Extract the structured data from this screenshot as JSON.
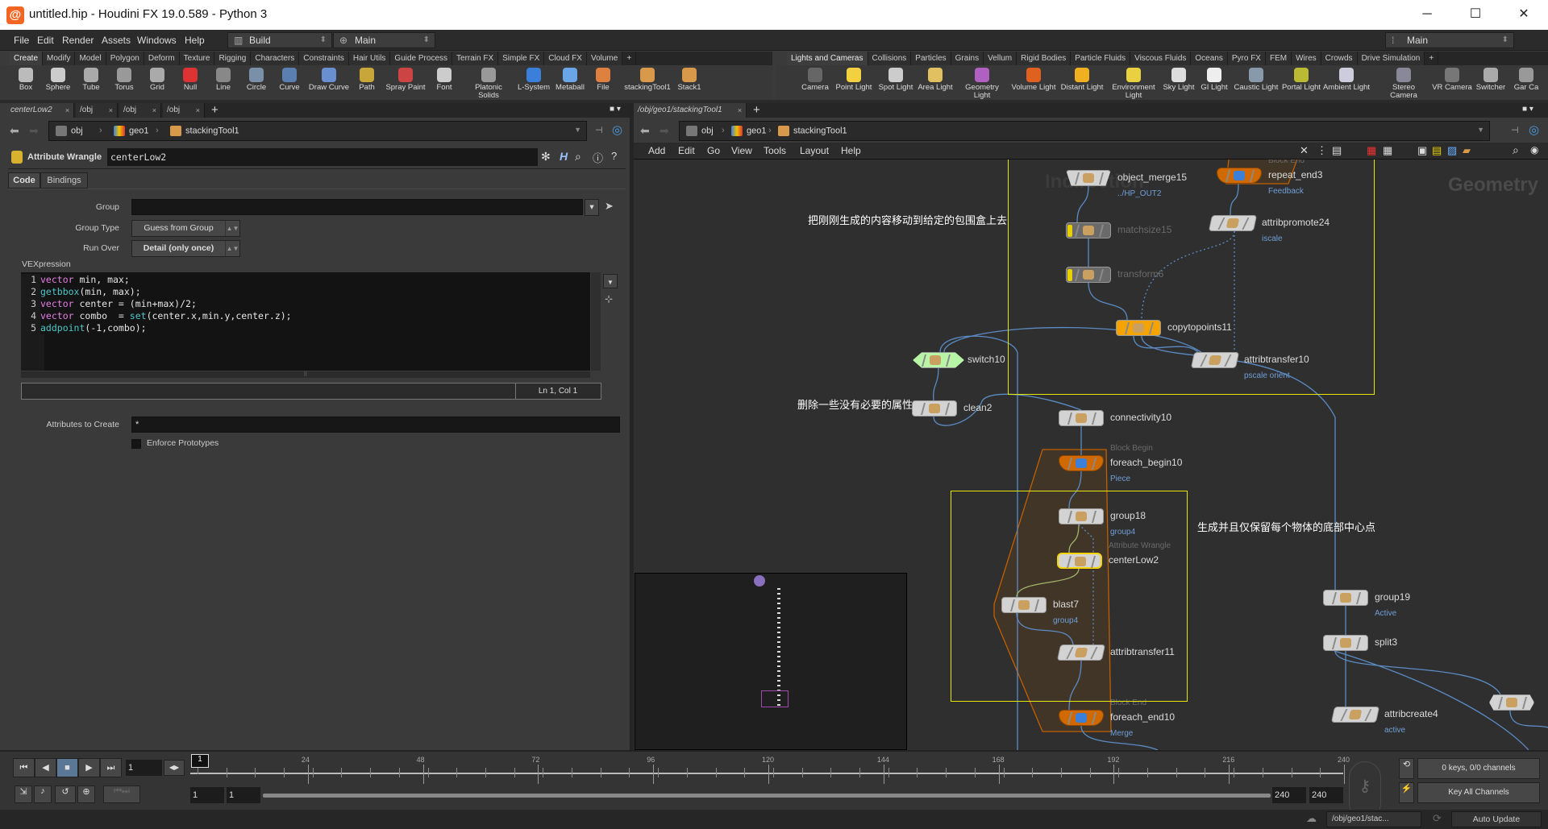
{
  "window": {
    "title": "untitled.hip - Houdini FX 19.0.589 - Python 3",
    "logo": "houdini-logo",
    "minimize": "─",
    "maximize": "☐",
    "close": "✕"
  },
  "menubar": {
    "items": [
      "File",
      "Edit",
      "Render",
      "Assets",
      "Windows",
      "Help"
    ],
    "desktop": "Build",
    "context": "Main",
    "right_context": "Main"
  },
  "shelf_left": {
    "tabs": [
      "Create",
      "Modify",
      "Model",
      "Polygon",
      "Deform",
      "Texture",
      "Rigging",
      "Characters",
      "Constraints",
      "Hair Utils",
      "Guide Process",
      "Terrain FX",
      "Simple FX",
      "Cloud FX",
      "Volume"
    ],
    "active_tab": "Create",
    "tools": [
      "Box",
      "Sphere",
      "Tube",
      "Torus",
      "Grid",
      "Null",
      "Line",
      "Circle",
      "Curve",
      "Draw Curve",
      "Path",
      "Spray Paint",
      "Font",
      "Platonic Solids",
      "L-System",
      "Metaball",
      "File",
      "stackingTool1",
      "Stack1"
    ]
  },
  "shelf_right": {
    "tabs": [
      "Lights and Cameras",
      "Collisions",
      "Particles",
      "Grains",
      "Vellum",
      "Rigid Bodies",
      "Particle Fluids",
      "Viscous Fluids",
      "Oceans",
      "Pyro FX",
      "FEM",
      "Wires",
      "Crowds",
      "Drive Simulation"
    ],
    "active_tab": "Lights and Cameras",
    "tools": [
      "Camera",
      "Point Light",
      "Spot Light",
      "Area Light",
      "Geometry Light",
      "Volume Light",
      "Distant Light",
      "Environment Light",
      "Sky Light",
      "GI Light",
      "Caustic Light",
      "Portal Light",
      "Ambient Light",
      "Stereo Camera",
      "VR Camera",
      "Switcher",
      "Gar Ca"
    ]
  },
  "left_pane": {
    "tabs": [
      "centerLow2",
      "/obj",
      "/obj",
      "/obj"
    ],
    "path": [
      "obj",
      "geo1",
      "stackingTool1"
    ],
    "node_type": "Attribute Wrangle",
    "node_name": "centerLow2",
    "param_tabs": [
      "Code",
      "Bindings"
    ],
    "params": {
      "group_label": "Group",
      "group_value": "",
      "group_type_label": "Group Type",
      "group_type_value": "Guess from Group",
      "run_over_label": "Run Over",
      "run_over_value": "Detail (only once)",
      "vex_label": "VEXpression",
      "attrs_label": "Attributes to Create",
      "attrs_value": "*",
      "enforce_label": "Enforce Prototypes",
      "enforce_checked": false
    },
    "code_lines": [
      [
        {
          "t": "vector",
          "c": "kw"
        },
        {
          "t": " min, max;"
        }
      ],
      [
        {
          "t": "getbbox",
          "c": "fn"
        },
        {
          "t": "(min, max);"
        }
      ],
      [
        {
          "t": "vector",
          "c": "kw"
        },
        {
          "t": " center = (min+max)/2;"
        }
      ],
      [
        {
          "t": "vector",
          "c": "kw"
        },
        {
          "t": " combo  = "
        },
        {
          "t": "set",
          "c": "fn"
        },
        {
          "t": "(center.x,min.y,center.z);"
        }
      ],
      [
        {
          "t": "addpoint",
          "c": "fn"
        },
        {
          "t": "(-1,combo);"
        }
      ]
    ],
    "cursor": "Ln 1, Col 1"
  },
  "network": {
    "tab": "/obj/geo1/stackingTool1",
    "path": [
      "obj",
      "geo1",
      "stackingTool1"
    ],
    "menu": [
      "Add",
      "Edit",
      "Go",
      "View",
      "Tools",
      "Layout",
      "Help"
    ],
    "context_watermark": "Geometry",
    "faint_watermark": "Indirection",
    "annotations": [
      "把刚刚生成的内容移动到给定的包围盒上去",
      "删除一些没有必要的属性",
      "生成并且仅保留每个物体的底部中心点"
    ],
    "nodes": [
      {
        "name": "object_merge15",
        "sub": "../HP_OUT2",
        "type": ""
      },
      {
        "name": "matchsize15",
        "sub": "",
        "type": ""
      },
      {
        "name": "transform6",
        "sub": "",
        "type": ""
      },
      {
        "name": "repeat_end3",
        "sub": "Feedback",
        "type": "Block End"
      },
      {
        "name": "attribpromote24",
        "sub": "iscale",
        "type": ""
      },
      {
        "name": "copytopoints11",
        "sub": "",
        "type": ""
      },
      {
        "name": "attribtransfer10",
        "sub": "pscale orient",
        "type": ""
      },
      {
        "name": "switch10",
        "sub": "",
        "type": ""
      },
      {
        "name": "clean2",
        "sub": "",
        "type": ""
      },
      {
        "name": "connectivity10",
        "sub": "",
        "type": ""
      },
      {
        "name": "foreach_begin10",
        "sub": "Piece",
        "type": "Block Begin"
      },
      {
        "name": "group18",
        "sub": "group4",
        "type": ""
      },
      {
        "name": "centerLow2",
        "sub": "",
        "type": "Attribute Wrangle"
      },
      {
        "name": "blast7",
        "sub": "group4",
        "type": ""
      },
      {
        "name": "attribtransfer11",
        "sub": "",
        "type": ""
      },
      {
        "name": "foreach_end10",
        "sub": "Merge",
        "type": "Block End"
      },
      {
        "name": "group19",
        "sub": "Active",
        "type": ""
      },
      {
        "name": "split3",
        "sub": "",
        "type": ""
      },
      {
        "name": "attribcreate4",
        "sub": "active",
        "type": ""
      },
      {
        "name": "",
        "sub": "",
        "type": ""
      }
    ]
  },
  "timeline": {
    "current_frame": "1",
    "marker": "1",
    "ticks": [
      "24",
      "48",
      "72",
      "96",
      "120",
      "144",
      "168",
      "192",
      "216",
      "240"
    ],
    "start": "1",
    "start2": "1",
    "end": "240",
    "end2": "240",
    "keys_info": "0 keys, 0/0 channels",
    "key_mode": "Key All Channels"
  },
  "statusbar": {
    "path": "/obj/geo1/stac...",
    "update_mode": "Auto Update"
  },
  "colors": {
    "accent_yellow": "#e8e800",
    "wire": "#5b8bc4",
    "foreach_orange": "#d06a00",
    "copy_orange": "#f5a300",
    "switch_green": "#b9f5a6",
    "sub_blue": "#6f9fd8"
  }
}
